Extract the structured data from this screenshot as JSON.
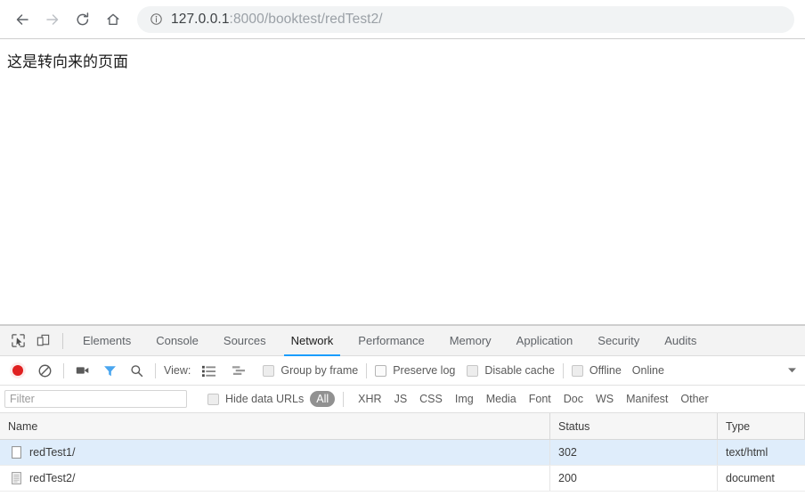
{
  "browser": {
    "nav": {
      "back_label": "Back",
      "forward_label": "Forward",
      "reload_label": "Reload",
      "home_label": "Home"
    },
    "omnibox": {
      "info_icon": "info-circle-icon",
      "url_host": "127.0.0.1",
      "url_path": ":8000/booktest/redTest2/",
      "url_full": "127.0.0.1:8000/booktest/redTest2/"
    }
  },
  "page": {
    "body_text": "这是转向来的页面"
  },
  "devtools": {
    "tools": {
      "inspect_icon": "inspect-cursor-icon",
      "device_icon": "device-toolbar-icon"
    },
    "tabs": [
      {
        "label": "Elements",
        "active": false
      },
      {
        "label": "Console",
        "active": false
      },
      {
        "label": "Sources",
        "active": false
      },
      {
        "label": "Network",
        "active": true
      },
      {
        "label": "Performance",
        "active": false
      },
      {
        "label": "Memory",
        "active": false
      },
      {
        "label": "Application",
        "active": false
      },
      {
        "label": "Security",
        "active": false
      },
      {
        "label": "Audits",
        "active": false
      }
    ],
    "controls": {
      "record_icon": "record-circle-icon",
      "clear_icon": "clear-prohibited-icon",
      "capture_screenshots_icon": "camera-icon",
      "filter_icon": "funnel-icon",
      "search_icon": "search-icon",
      "view_label": "View:",
      "view_list_icon": "list-view-icon",
      "view_waterfall_icon": "waterfall-view-icon",
      "group_by_frame_label": "Group by frame",
      "preserve_log_label": "Preserve log",
      "disable_cache_label": "Disable cache",
      "offline_label": "Offline",
      "throttling_value": "Online",
      "throttling_arrow_icon": "chevron-down-icon"
    },
    "filter_bar": {
      "filter_placeholder": "Filter",
      "filter_value": "",
      "hide_data_urls_label": "Hide data URLs",
      "types": [
        {
          "label": "All",
          "selected": true
        },
        {
          "label": "XHR",
          "selected": false
        },
        {
          "label": "JS",
          "selected": false
        },
        {
          "label": "CSS",
          "selected": false
        },
        {
          "label": "Img",
          "selected": false
        },
        {
          "label": "Media",
          "selected": false
        },
        {
          "label": "Font",
          "selected": false
        },
        {
          "label": "Doc",
          "selected": false
        },
        {
          "label": "WS",
          "selected": false
        },
        {
          "label": "Manifest",
          "selected": false
        },
        {
          "label": "Other",
          "selected": false
        }
      ]
    },
    "network_table": {
      "columns": [
        "Name",
        "Status",
        "Type"
      ],
      "rows": [
        {
          "name": "redTest1/",
          "status": "302",
          "type": "text/html",
          "selected": true,
          "icon": "blank-document-icon"
        },
        {
          "name": "redTest2/",
          "status": "200",
          "type": "document",
          "selected": false,
          "icon": "text-document-icon"
        }
      ]
    }
  },
  "colors": {
    "accent_blue": "#1a9dfd",
    "record_red": "#e02020",
    "row_selected": "#dfedfb",
    "filter_active": "#4aa6ef"
  }
}
